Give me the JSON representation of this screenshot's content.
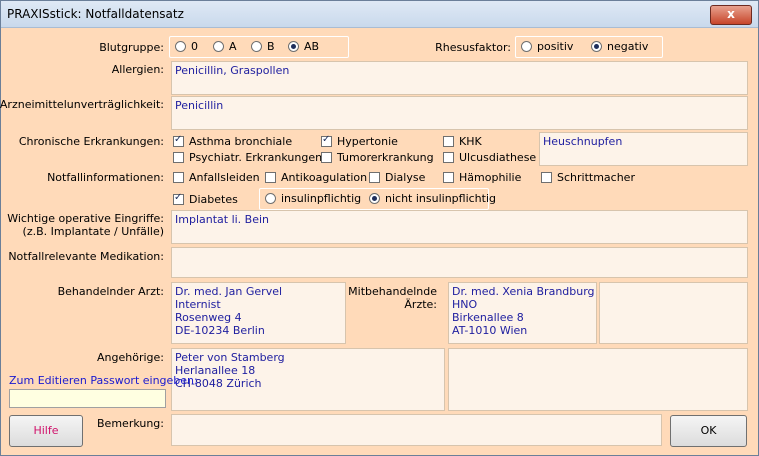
{
  "window": {
    "title": "PRAXISstick: Notfalldatensatz",
    "close": "x"
  },
  "blutgruppe": {
    "label": "Blutgruppe:",
    "options": [
      "0",
      "A",
      "B",
      "AB"
    ],
    "selected": "AB"
  },
  "rhesus": {
    "label": "Rhesusfaktor:",
    "options": [
      "positiv",
      "negativ"
    ],
    "selected": "negativ"
  },
  "allergien": {
    "label": "Allergien:",
    "value": "Penicillin, Graspollen"
  },
  "unvertraeglich": {
    "label": "Arzneimittelunverträglichkeit:",
    "value": "Penicillin"
  },
  "chronisch": {
    "label": "Chronische Erkrankungen:",
    "items": [
      {
        "label": "Asthma bronchiale",
        "checked": true
      },
      {
        "label": "Hypertonie",
        "checked": true
      },
      {
        "label": "KHK",
        "checked": false
      },
      {
        "label": "Psychiatr. Erkrankungen",
        "checked": false
      },
      {
        "label": "Tumorerkrankung",
        "checked": false
      },
      {
        "label": "Ulcusdiathese",
        "checked": false
      }
    ],
    "other": "Heuschnupfen"
  },
  "notfall": {
    "label": "Notfallinformationen:",
    "items": [
      {
        "label": "Anfallsleiden",
        "checked": false
      },
      {
        "label": "Antikoagulation",
        "checked": false
      },
      {
        "label": "Dialyse",
        "checked": false
      },
      {
        "label": "Hämophilie",
        "checked": false
      },
      {
        "label": "Schrittmacher",
        "checked": false
      },
      {
        "label": "Diabetes",
        "checked": true
      }
    ],
    "insulin_options": [
      "insulinpflichtig",
      "nicht insulinpflichtig"
    ],
    "insulin_selected": "nicht insulinpflichtig"
  },
  "eingriffe": {
    "label1": "Wichtige operative Eingriffe:",
    "label2": "(z.B. Implantate / Unfälle)",
    "value": "Implantat li. Bein"
  },
  "medikation": {
    "label": "Notfallrelevante Medikation:",
    "value": ""
  },
  "arzt": {
    "label": "Behandelnder Arzt:",
    "lines": [
      "Dr. med. Jan Gervel",
      "Internist",
      "Rosenweg 4",
      "DE-10234 Berlin"
    ]
  },
  "mitbehandelnd": {
    "label1": "Mitbehandelnde",
    "label2": "Ärzte:",
    "lines": [
      "Dr. med. Xenia Brandburg",
      "HNO",
      "Birkenallee 8",
      "AT-1010 Wien"
    ],
    "second": []
  },
  "angehoerige": {
    "label": "Angehörige:",
    "lines": [
      "Peter von Stamberg",
      "Herlanallee 18",
      "CH-8048 Zürich"
    ],
    "second": []
  },
  "passwort": {
    "link": "Zum Editieren Passwort eingeben:",
    "value": ""
  },
  "bemerkung": {
    "label": "Bemerkung:",
    "value": ""
  },
  "buttons": {
    "help": "Hilfe",
    "ok": "OK"
  },
  "colors": {
    "background": "#ffdab9",
    "field": "#fdf3e9",
    "text": "#2020a0",
    "help": "#d0106a"
  }
}
